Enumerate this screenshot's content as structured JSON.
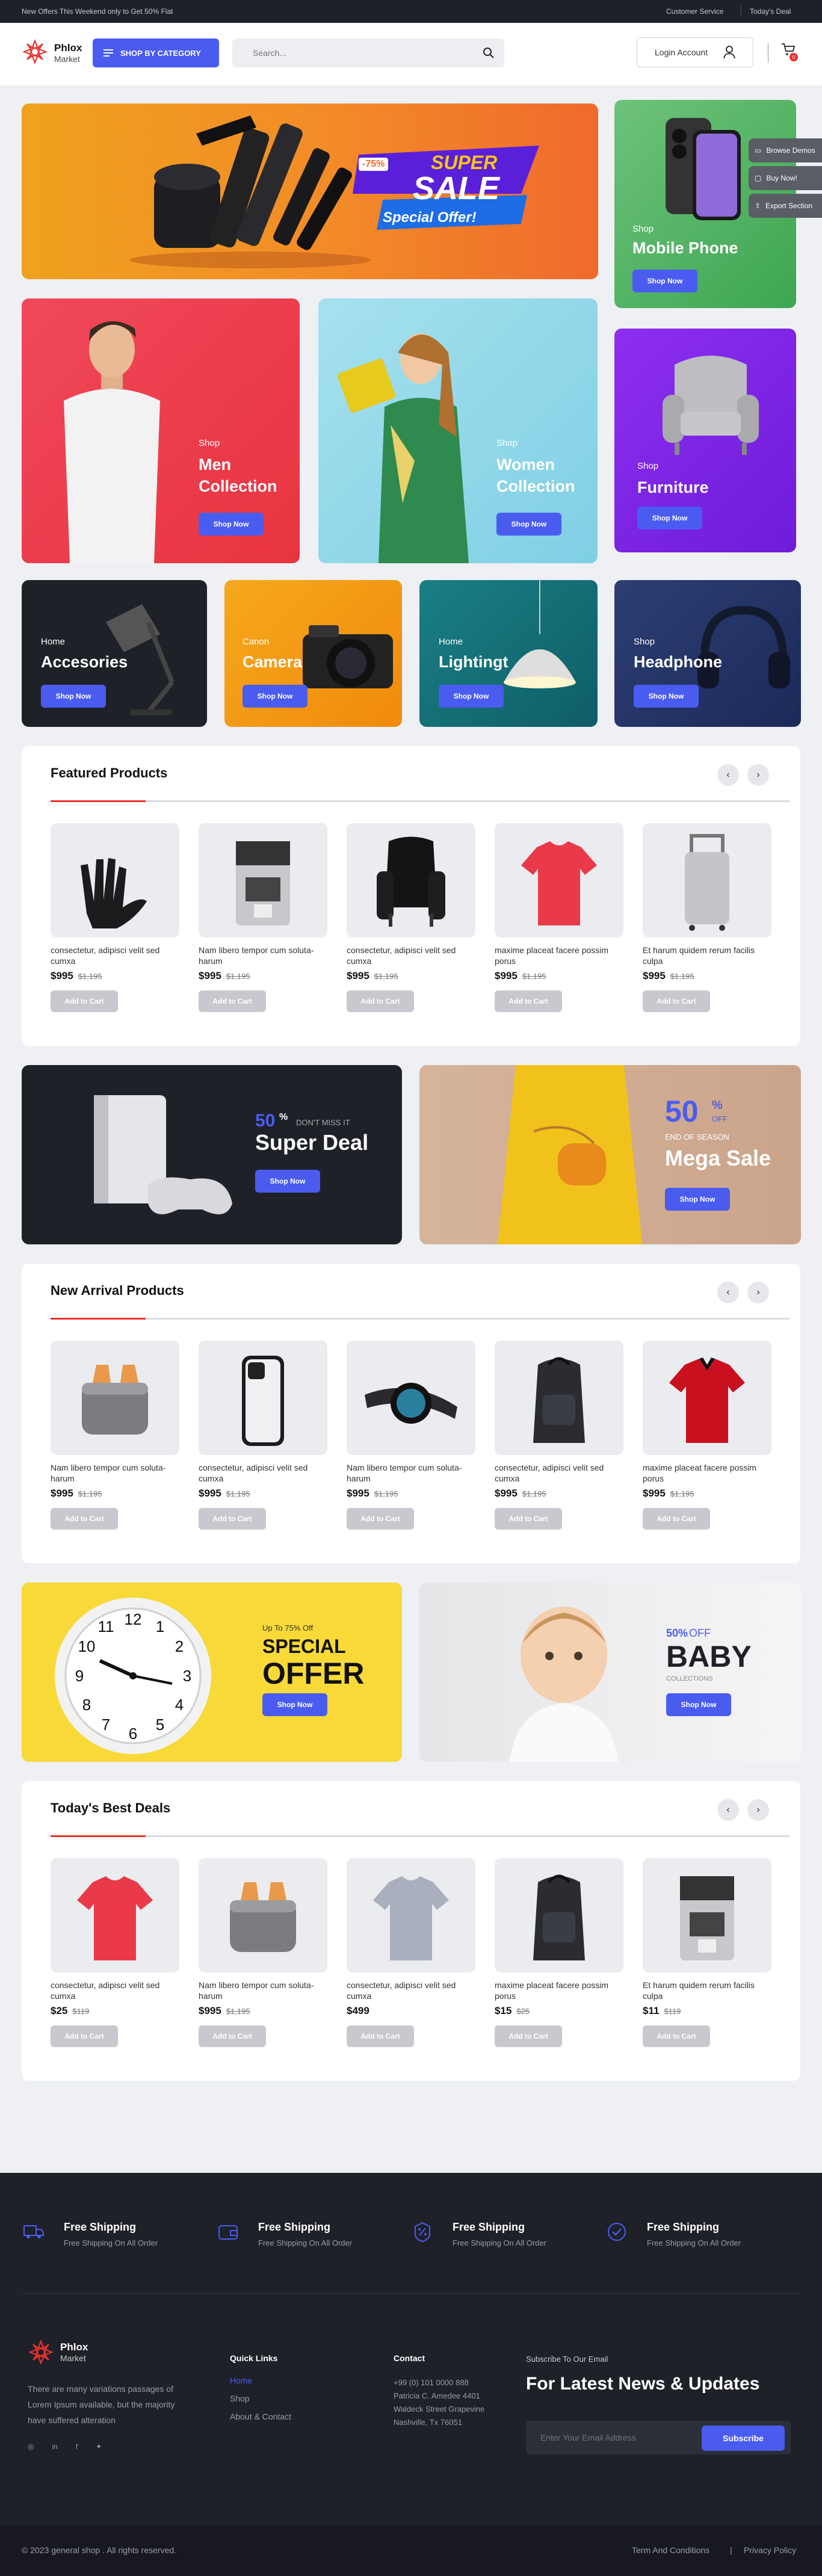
{
  "topbar": {
    "promo": "New Offers This Weekend only to Get 50% Flat",
    "customer_service": "Customer Service",
    "todays_deal": "Today's Deal"
  },
  "header": {
    "logo_name": "Phlox",
    "logo_sub": "Market",
    "category_button": "SHOP BY CATEGORY",
    "search_placeholder": "Search...",
    "login": "Login Account",
    "cart_count": "0"
  },
  "hero": {
    "discount": "-75%",
    "super": "SUPER",
    "sale": "SALE",
    "special_offer": "Special Offer!"
  },
  "side_tools": [
    "Browse Demos",
    "Buy Now!",
    "Export Section"
  ],
  "banners": [
    {
      "kicker": "Shop",
      "title": "Mobile Phone",
      "button": "Shop Now"
    },
    {
      "kicker": "Shop",
      "title": "Men Collection",
      "button": "Shop Now"
    },
    {
      "kicker": "Shop",
      "title": "Women Collection",
      "button": "Shop Now"
    },
    {
      "kicker": "Shop",
      "title": "Furniture",
      "button": "Shop Now"
    },
    {
      "kicker": "Home",
      "title": "Accesories",
      "button": "Shop Now"
    },
    {
      "kicker": "Canon",
      "title": "Camera",
      "button": "Shop Now"
    },
    {
      "kicker": "Home",
      "title": "Lightingt",
      "button": "Shop Now"
    },
    {
      "kicker": "Shop",
      "title": "Headphone",
      "button": "Shop Now"
    }
  ],
  "featured": {
    "title": "Featured Products",
    "items": [
      {
        "name": "consectetur, adipisci velit sed cumxa",
        "price": "$995",
        "old": "$1,195",
        "button": "Add to Cart",
        "img": "gloves"
      },
      {
        "name": "Nam libero tempor cum soluta-harum",
        "price": "$995",
        "old": "$1,195",
        "button": "Add to Cart",
        "img": "coffee-machine"
      },
      {
        "name": "consectetur, adipisci velit sed cumxa",
        "price": "$995",
        "old": "$1,195",
        "button": "Add to Cart",
        "img": "armchair"
      },
      {
        "name": "maxime placeat facere possim porus",
        "price": "$995",
        "old": "$1,195",
        "button": "Add to Cart",
        "img": "red-tshirt"
      },
      {
        "name": "Et harum quidem rerum facilis culpa",
        "price": "$995",
        "old": "$1,195",
        "button": "Add to Cart",
        "img": "suitcase"
      }
    ]
  },
  "promo1": {
    "percent": "50",
    "pct_sign": "%",
    "dont_miss": "DON'T MISS IT",
    "title": "Super Deal",
    "button": "Shop Now"
  },
  "promo2": {
    "percent": "50",
    "pct_sign": "%",
    "off": "OFF",
    "end_season": "END OF SEASON",
    "title": "Mega Sale",
    "button": "Shop Now"
  },
  "arrivals": {
    "title": "New Arrival Products",
    "items": [
      {
        "name": "Nam libero tempor cum soluta-harum",
        "price": "$995",
        "old": "$1,195",
        "button": "Add to Cart",
        "img": "toaster"
      },
      {
        "name": "consectetur, adipisci velit sed cumxa",
        "price": "$995",
        "old": "$1,195",
        "button": "Add to Cart",
        "img": "iphone"
      },
      {
        "name": "Nam libero tempor cum soluta-harum",
        "price": "$995",
        "old": "$1,195",
        "button": "Add to Cart",
        "img": "smartwatch"
      },
      {
        "name": "consectetur, adipisci velit sed cumxa",
        "price": "$995",
        "old": "$1,195",
        "button": "Add to Cart",
        "img": "backpack"
      },
      {
        "name": "maxime placeat facere possim porus",
        "price": "$995",
        "old": "$1,195",
        "button": "Add to Cart",
        "img": "polo"
      }
    ]
  },
  "promo3": {
    "upto": "Up To 75% Off",
    "special": "SPECIAL",
    "offer": "OFFER",
    "button": "Shop Now"
  },
  "promo4": {
    "percent": "50%",
    "off": "OFF",
    "title": "BABY",
    "sub": "COLLECTIONS",
    "button": "Shop Now"
  },
  "deals": {
    "title": "Today's Best Deals",
    "items": [
      {
        "name": "consectetur, adipisci velit sed cumxa",
        "price": "$25",
        "old": "$119",
        "button": "Add to Cart",
        "img": "red-tshirt"
      },
      {
        "name": "Nam libero tempor cum soluta-harum",
        "price": "$995",
        "old": "$1,195",
        "button": "Add to Cart",
        "img": "toaster"
      },
      {
        "name": "consectetur, adipisci velit sed cumxa",
        "price": "$499",
        "old": "",
        "button": "Add to Cart",
        "img": "grey-tshirt"
      },
      {
        "name": "maxime placeat facere possim porus",
        "price": "$15",
        "old": "$25",
        "button": "Add to Cart",
        "img": "backpack"
      },
      {
        "name": "Et harum quidem rerum facilis culpa",
        "price": "$11",
        "old": "$119",
        "button": "Add to Cart",
        "img": "coffee-machine"
      }
    ]
  },
  "features": [
    {
      "title": "Free Shipping",
      "sub": "Free Shipping On All Order",
      "icon": "truck-icon"
    },
    {
      "title": "Free Shipping",
      "sub": "Free Shipping On All Order",
      "icon": "wallet-icon"
    },
    {
      "title": "Free Shipping",
      "sub": "Free Shipping On All Order",
      "icon": "percent-icon"
    },
    {
      "title": "Free Shipping",
      "sub": "Free Shipping On All Order",
      "icon": "badge-check-icon"
    }
  ],
  "footer": {
    "logo_name": "Phlox",
    "logo_sub": "Market",
    "about": "There are many variations passages of Lorem Ipsum available, but the majority have suffered alteration",
    "quick_title": "Quick Links",
    "quick_links": [
      "Home",
      "Shop",
      "About & Contact"
    ],
    "contact_title": "Contact",
    "contact_lines": [
      "+99 (0) 101 0000 888",
      "Patricia C. Amedee 4401",
      "Waldeck Street Grapevine",
      "Nashville, Tx 76051"
    ],
    "subscribe_label": "Subscribe To Our Email",
    "subscribe_heading": "For Latest News & Updates",
    "email_placeholder": "Enter Your Email Address",
    "subscribe_button": "Subscribe",
    "copyright": "© 2023 general shop . All rights reserved.",
    "terms": "Term And Conditions",
    "privacy": "Privacy Policy"
  },
  "colors": {
    "accent": "#4a5cf0",
    "red": "#e8332c",
    "dark": "#1f2129"
  }
}
